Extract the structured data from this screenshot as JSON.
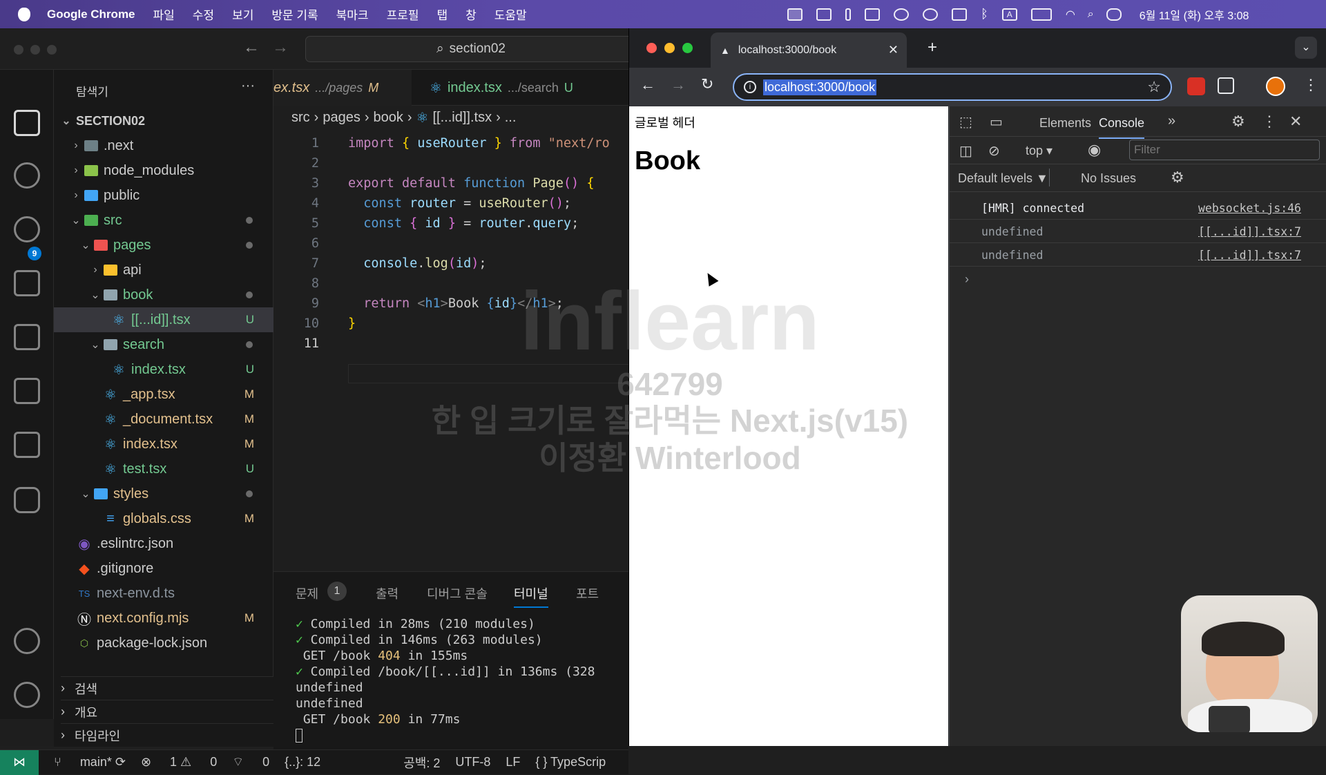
{
  "menubar": {
    "app": "Google Chrome",
    "items": [
      "파일",
      "수정",
      "보기",
      "방문 기록",
      "북마크",
      "프로필",
      "탭",
      "창",
      "도움말"
    ],
    "clock": "6월 11일 (화) 오후 3:08"
  },
  "vscode": {
    "search_label": "section02",
    "explorer_title": "탐색기",
    "more": "···",
    "root": "SECTION02",
    "tree": [
      {
        "label": ".next",
        "status": "",
        "kind": "folder"
      },
      {
        "label": "node_modules",
        "status": "",
        "kind": "folder"
      },
      {
        "label": "public",
        "status": "",
        "kind": "folder"
      },
      {
        "label": "src",
        "status": "",
        "kind": "folder"
      },
      {
        "label": "pages",
        "status": "",
        "kind": "folder"
      },
      {
        "label": "api",
        "status": "",
        "kind": "folder"
      },
      {
        "label": "book",
        "status": "",
        "kind": "folder"
      },
      {
        "label": "[[...id]].tsx",
        "status": "U",
        "kind": "react"
      },
      {
        "label": "search",
        "status": "",
        "kind": "folder"
      },
      {
        "label": "index.tsx",
        "status": "U",
        "kind": "react"
      },
      {
        "label": "_app.tsx",
        "status": "M",
        "kind": "react"
      },
      {
        "label": "_document.tsx",
        "status": "M",
        "kind": "react"
      },
      {
        "label": "index.tsx",
        "status": "M",
        "kind": "react"
      },
      {
        "label": "test.tsx",
        "status": "U",
        "kind": "react"
      },
      {
        "label": "styles",
        "status": "",
        "kind": "folder"
      },
      {
        "label": "globals.css",
        "status": "M",
        "kind": "css"
      },
      {
        "label": ".eslintrc.json",
        "status": "",
        "kind": "file"
      },
      {
        "label": ".gitignore",
        "status": "",
        "kind": "file"
      },
      {
        "label": "next-env.d.ts",
        "status": "",
        "kind": "file"
      },
      {
        "label": "next.config.mjs",
        "status": "M",
        "kind": "file"
      },
      {
        "label": "package-lock.json",
        "status": "",
        "kind": "file"
      }
    ],
    "scm_badge": "9",
    "tabs": [
      {
        "name": "ex.tsx",
        "path": ".../pages",
        "status": "M"
      },
      {
        "name": "index.tsx",
        "path": ".../search",
        "status": "U"
      }
    ],
    "breadcrumb": [
      "src",
      "pages",
      "book",
      "[[...id]].tsx",
      "..."
    ],
    "line_numbers": [
      "1",
      "2",
      "3",
      "4",
      "5",
      "6",
      "7",
      "8",
      "9",
      "10",
      "11"
    ],
    "panel_tabs": [
      "문제",
      "출력",
      "디버그 콘솔",
      "터미널",
      "포트"
    ],
    "problems_count": "1",
    "terminal": {
      "l1a": "✓",
      "l1b": " Compiled in 28ms (210 modules)",
      "l2a": "✓",
      "l2b": " Compiled in 146ms (263 modules)",
      "l3a": " GET /book ",
      "l3b": "404",
      "l3c": " in 155ms",
      "l4a": "✓",
      "l4b": " Compiled /book/[[...id]] in 136ms (328",
      "l5": "undefined",
      "l6": "undefined",
      "l7a": " GET /book ",
      "l7b": "200",
      "l7c": " in 77ms"
    },
    "outline": [
      "검색",
      "개요",
      "타임라인"
    ],
    "status": {
      "branch": "main*",
      "errors": "1",
      "warnings": "0",
      "ports": "0",
      "json": "{..}: 12",
      "spaces": "공백: 2",
      "encoding": "UTF-8",
      "eol": "LF",
      "lang": "{ } TypeScrip"
    }
  },
  "chrome": {
    "tab_title": "localhost:3000/book",
    "new_tab": "+",
    "url": "localhost:3000/book",
    "page": {
      "header": "글로벌 헤더",
      "title": "Book"
    },
    "devtools": {
      "tabs": [
        "Elements",
        "Console"
      ],
      "context": "top",
      "filter_placeholder": "Filter",
      "levels": "Default levels ▼",
      "issues": "No Issues",
      "logs": [
        {
          "msg": "[HMR] connected",
          "src": "websocket.js:46"
        },
        {
          "msg": "undefined",
          "src": "[[...id]].tsx:7"
        },
        {
          "msg": "undefined",
          "src": "[[...id]].tsx:7"
        }
      ]
    }
  },
  "watermark": {
    "brand": "inflearn",
    "id": "642799",
    "line1": "한 입 크기로 잘라먹는 Next.js(v15)",
    "line2": "이정환 Winterlood"
  },
  "colors": {
    "accent": "#0078d4",
    "modified": "#e2c08d",
    "untracked": "#73c991",
    "statusRemote": "#16825d"
  }
}
